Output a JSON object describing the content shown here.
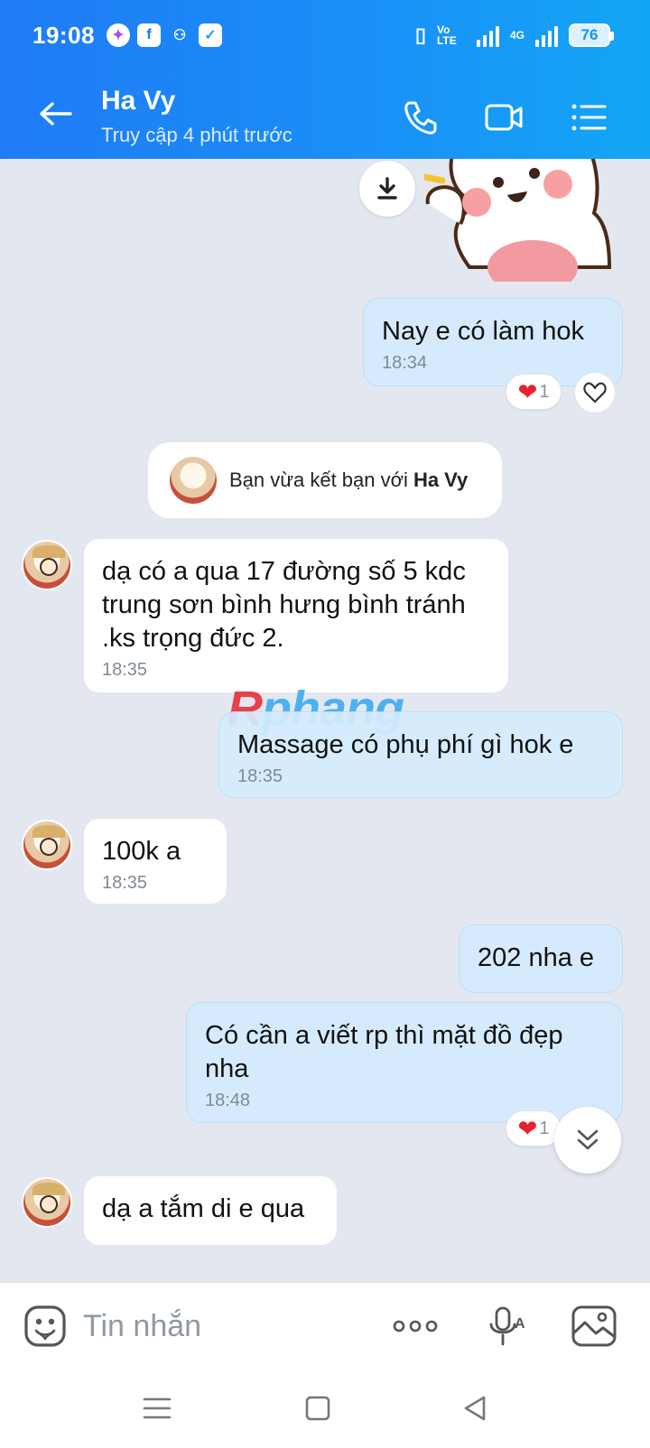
{
  "status_bar": {
    "time": "19:08",
    "network_label": "Vo LTE",
    "network2_label": "4G",
    "battery": "76"
  },
  "header": {
    "contact_name": "Ha Vy",
    "last_seen": "Truy cập 4 phút trước"
  },
  "messages": [
    {
      "dir": "out",
      "text": "Nay e có làm hok",
      "time": "18:34",
      "reaction_count": "1"
    },
    {
      "dir": "in",
      "text": "dạ có a qua 17 đường số 5 kdc trung sơn bình hưng  bình tránh .ks trọng đức 2.",
      "time": "18:35"
    },
    {
      "dir": "out",
      "text": "Massage có phụ phí gì hok e",
      "time": "18:35"
    },
    {
      "dir": "in",
      "text": "100k a",
      "time": "18:35"
    },
    {
      "dir": "out",
      "text": "202 nha e",
      "time": ""
    },
    {
      "dir": "out",
      "text": "Có cần a viết rp thì mặt đồ đẹp nha",
      "time": "18:48",
      "reaction_count": "1"
    },
    {
      "dir": "in",
      "text": "dạ a tắm di e qua",
      "time": ""
    }
  ],
  "system_message": {
    "prefix": "Bạn vừa kết bạn với",
    "name": "Ha Vy"
  },
  "watermark": {
    "part1": "R",
    "part2": "phang"
  },
  "input": {
    "placeholder": "Tin nhắn"
  },
  "colors": {
    "header_start": "#1f7bf6",
    "header_end": "#13a6f5",
    "out_bubble": "#d5ebfd",
    "in_bubble": "#ffffff",
    "chat_bg": "#e3e8f0",
    "heart": "#e8212c"
  },
  "icons": [
    "back-arrow-icon",
    "phone-icon",
    "video-call-icon",
    "menu-list-icon",
    "download-icon",
    "heart-icon",
    "chevron-double-down-icon",
    "emoji-icon",
    "more-icon",
    "voice-icon",
    "image-icon"
  ]
}
